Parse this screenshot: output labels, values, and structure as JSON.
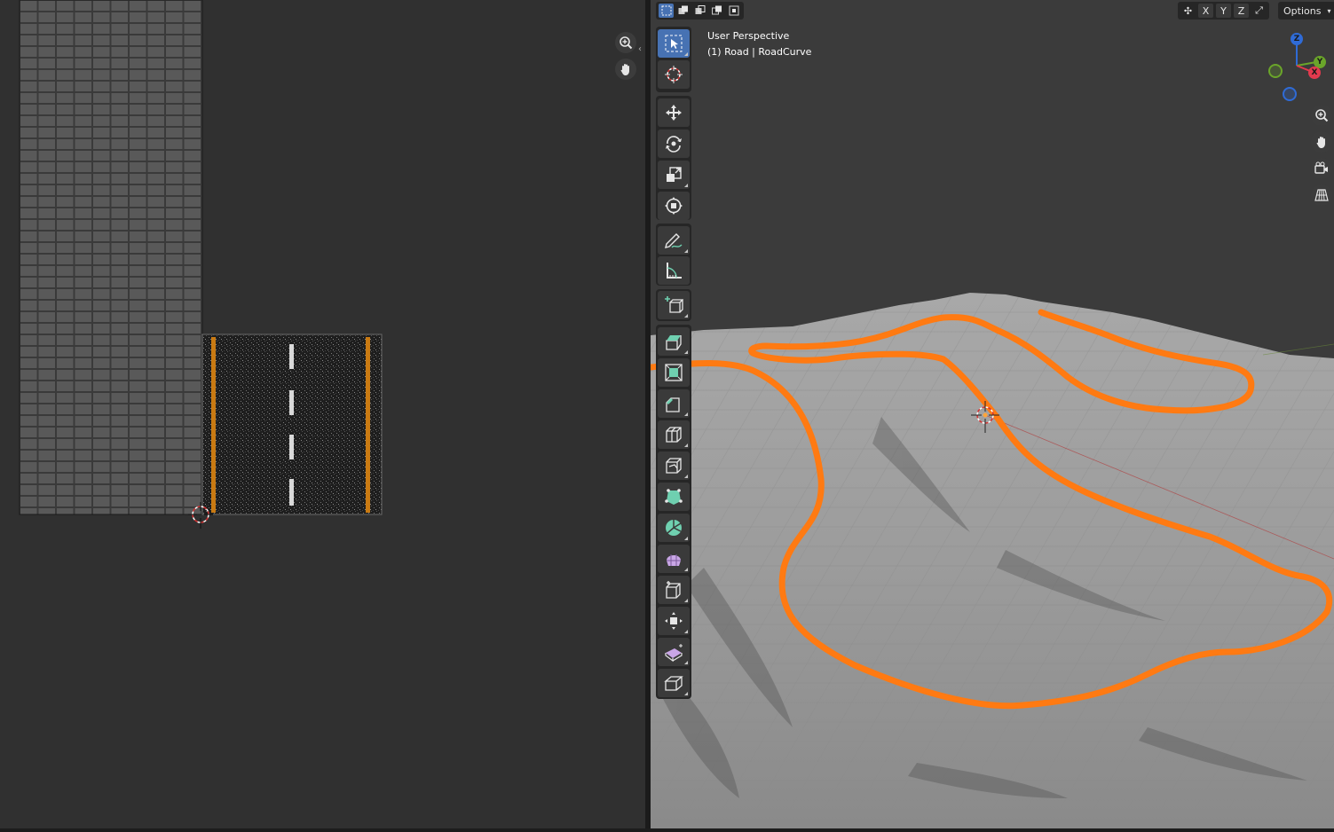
{
  "uv_editor": {
    "zoom_tool": "zoom-icon",
    "pan_tool": "hand-icon"
  },
  "viewport": {
    "view_name": "User Perspective",
    "object_info": "(1) Road | RoadCurve",
    "header": {
      "select_modes": [
        "select-box",
        "select-extend",
        "select-subtract",
        "select-invert",
        "select-intersect"
      ],
      "axis_x": "X",
      "axis_y": "Y",
      "axis_z": "Z",
      "options_label": "Options"
    },
    "gizmo": {
      "z_label": "Z",
      "y_label": "Y",
      "x_label": "X"
    },
    "nav_icons": [
      "zoom-icon",
      "hand-icon",
      "camera-icon",
      "grid-icon"
    ],
    "tools": [
      "select-box",
      "cursor",
      "move",
      "rotate",
      "scale",
      "transform",
      "annotate",
      "measure",
      "add-cube",
      "extrude-region",
      "inset-faces",
      "bevel",
      "loop-cut",
      "knife",
      "poly-build",
      "spin",
      "smooth",
      "edge-slide",
      "shrink-fatten",
      "shear",
      "rip-region"
    ],
    "colors": {
      "curve": "#ff7a12",
      "active_tool": "#4772b3",
      "terrain": "#9a9a9a"
    }
  }
}
